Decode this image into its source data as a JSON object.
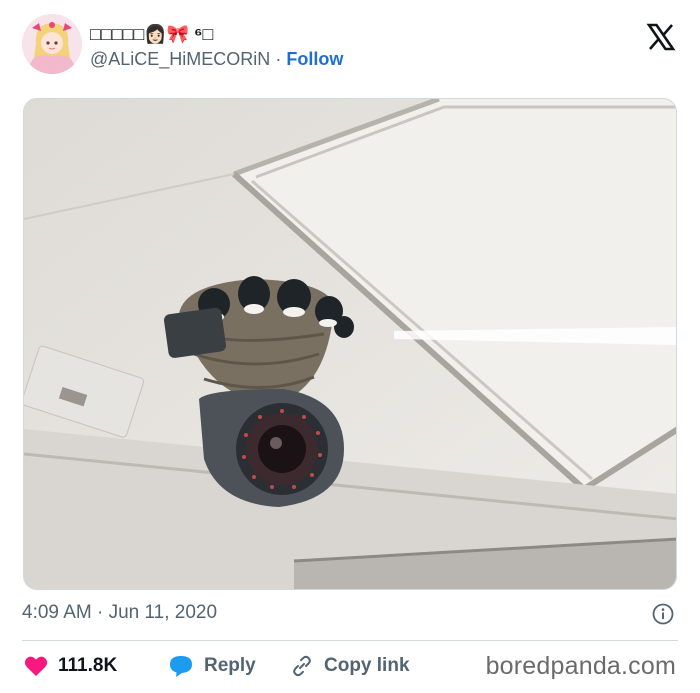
{
  "tweet": {
    "display_name": "□□□□□👩🏻🎀 ⁶□",
    "handle": "@ALiCE_HiMECORiN",
    "separator": "·",
    "follow_label": "Follow",
    "timestamp": "4:09 AM · Jun 11, 2020"
  },
  "icons": {
    "brand": "x-logo-icon",
    "info": "info-icon",
    "like": "heart-icon",
    "reply": "speech-bubble-icon",
    "copy": "link-icon"
  },
  "actions": {
    "likes": "111.8K",
    "reply_label": "Reply",
    "copy_label": "Copy link"
  },
  "watermark": "boredpanda.com",
  "colors": {
    "like": "#f91880",
    "reply": "#1d9bf0",
    "follow": "#1d6fd6",
    "muted": "#536471"
  }
}
